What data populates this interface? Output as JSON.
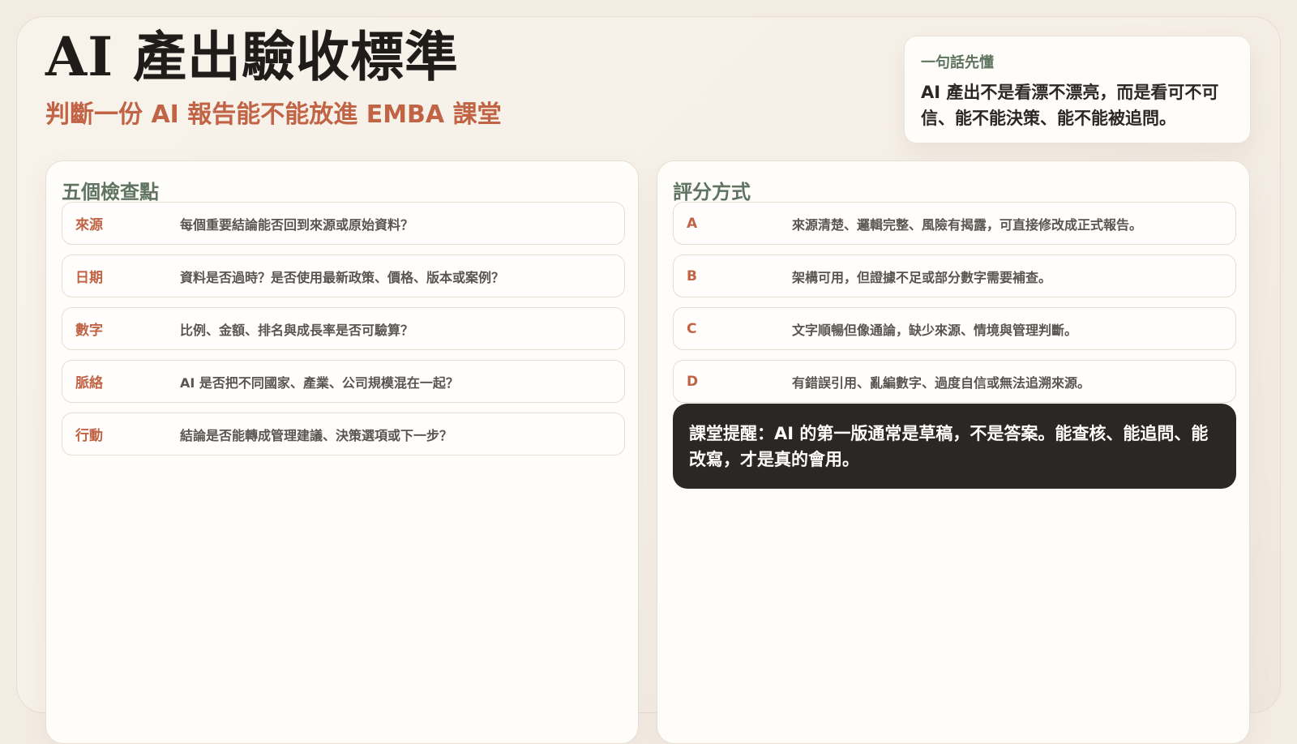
{
  "header": {
    "title": "AI 產出驗收標準",
    "subtitle": "判斷一份 AI 報告能不能放進 EMBA 課堂"
  },
  "summary": {
    "label": "一句話先懂",
    "text": "AI 產出不是看漂不漂亮，而是看可不可信、能不能決策、能不能被追問。"
  },
  "checkpoints": {
    "heading": "五個檢查點",
    "items": [
      {
        "key": "來源",
        "text": "每個重要結論能否回到來源或原始資料？"
      },
      {
        "key": "日期",
        "text": "資料是否過時？是否使用最新政策、價格、版本或案例？"
      },
      {
        "key": "數字",
        "text": "比例、金額、排名與成長率是否可驗算？"
      },
      {
        "key": "脈絡",
        "text": "AI 是否把不同國家、產業、公司規模混在一起？"
      },
      {
        "key": "行動",
        "text": "結論是否能轉成管理建議、決策選項或下一步？"
      }
    ]
  },
  "grading": {
    "heading": "評分方式",
    "items": [
      {
        "key": "A",
        "text": "來源清楚、邏輯完整、風險有揭露，可直接修改成正式報告。"
      },
      {
        "key": "B",
        "text": "架構可用，但證據不足或部分數字需要補查。"
      },
      {
        "key": "C",
        "text": "文字順暢但像通論，缺少來源、情境與管理判斷。"
      },
      {
        "key": "D",
        "text": "有錯誤引用、亂編數字、過度自信或無法追溯來源。"
      }
    ],
    "reminder": "課堂提醒：AI 的第一版通常是草稿，不是答案。能查核、能追問、能改寫，才是真的會用。"
  },
  "colors": {
    "accent": "#c16345",
    "heading_green": "#5f7460",
    "dark": "#2b2724",
    "background": "#f6f0e8"
  }
}
